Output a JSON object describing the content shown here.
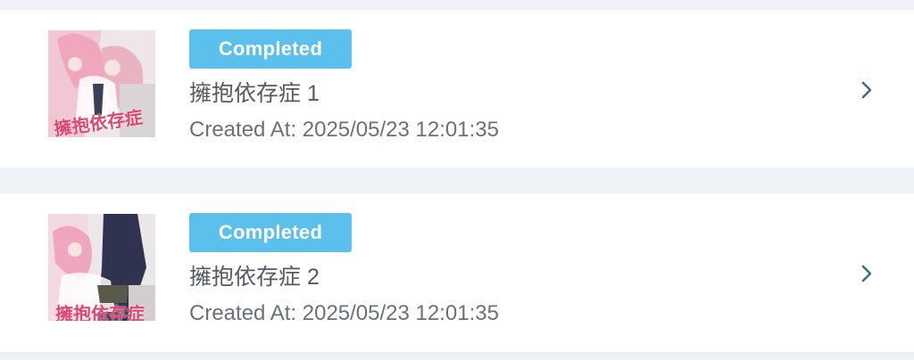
{
  "colors": {
    "badge_completed": "#5bc0eb",
    "page_background": "#eef2f6",
    "card_background": "#ffffff",
    "chevron": "#3d6e80"
  },
  "items": [
    {
      "status": "Completed",
      "title": "擁抱依存症 1",
      "created_label": "Created At:",
      "created_at": "2025/05/23 12:01:35",
      "thumbnail_text": "擁抱依存症",
      "chevron_icon": "chevron-right-icon"
    },
    {
      "status": "Completed",
      "title": "擁抱依存症 2",
      "created_label": "Created At:",
      "created_at": "2025/05/23 12:01:35",
      "thumbnail_text": "擁抱依存症",
      "chevron_icon": "chevron-right-icon"
    }
  ]
}
